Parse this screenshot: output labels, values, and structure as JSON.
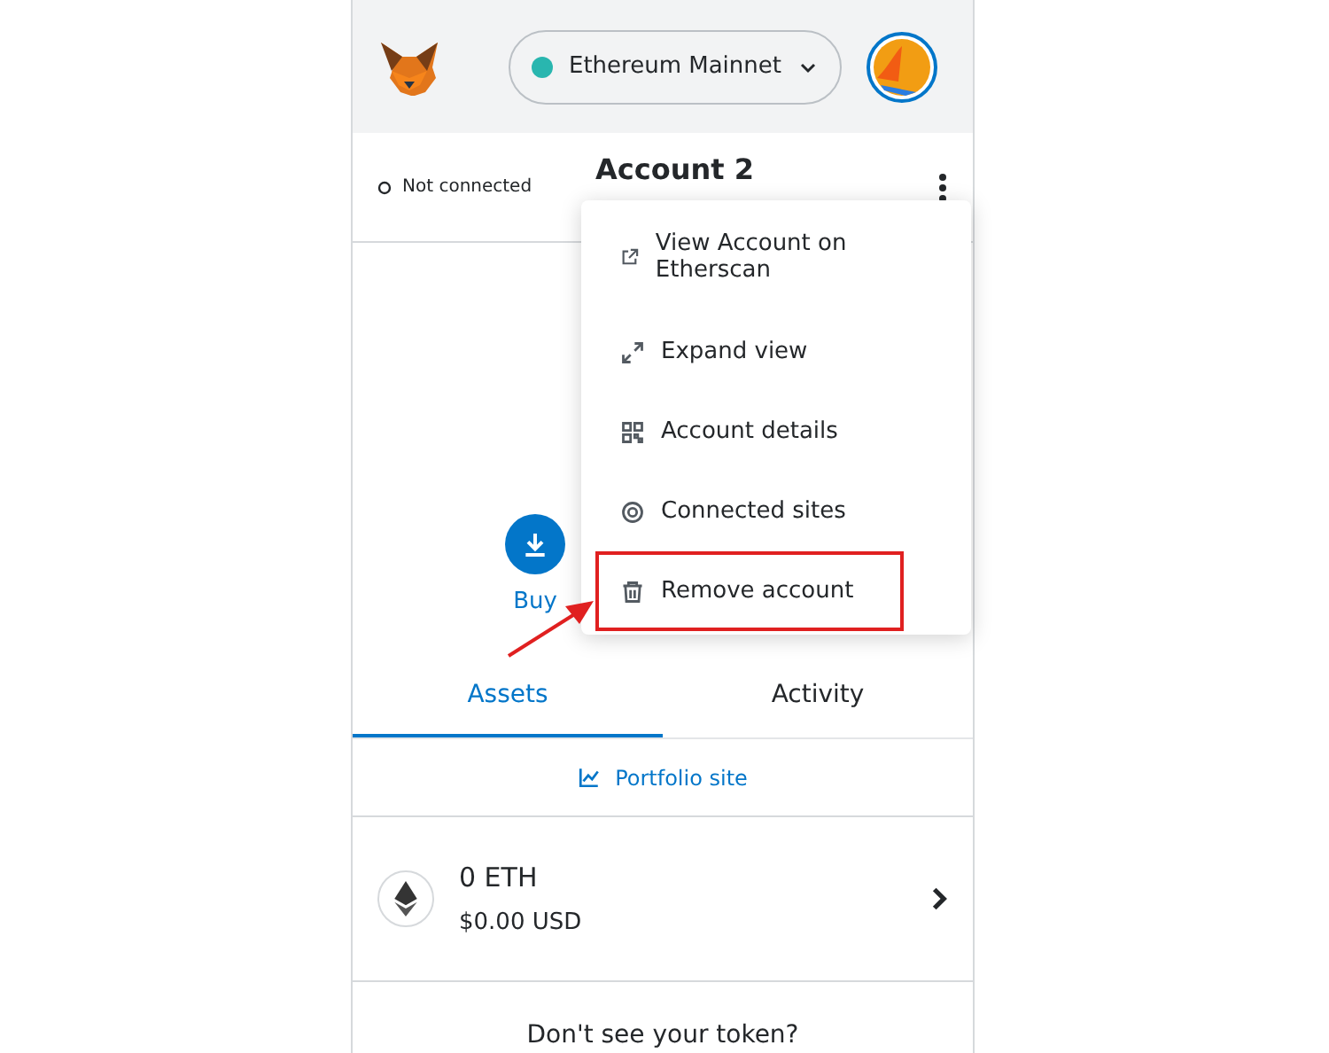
{
  "header": {
    "network": "Ethereum Mainnet"
  },
  "account_bar": {
    "connection": "Not connected",
    "account_name": "Account 2"
  },
  "actions": [
    {
      "label": "Buy"
    }
  ],
  "tabs": [
    {
      "label": "Assets",
      "selected": true
    },
    {
      "label": "Activity",
      "selected": false
    }
  ],
  "portfolio_link": "Portfolio site",
  "tokens": [
    {
      "amount": "0 ETH",
      "value": "$0.00 USD"
    }
  ],
  "footer_text": "Don't see your token?",
  "menu": [
    {
      "kind": "external",
      "label": "View Account on Etherscan",
      "highlighted": false
    },
    {
      "kind": "expand",
      "label": "Expand view",
      "highlighted": false
    },
    {
      "kind": "qr",
      "label": "Account details",
      "highlighted": false
    },
    {
      "kind": "sites",
      "label": "Connected sites",
      "highlighted": false
    },
    {
      "kind": "trash",
      "label": "Remove account",
      "highlighted": true
    }
  ]
}
